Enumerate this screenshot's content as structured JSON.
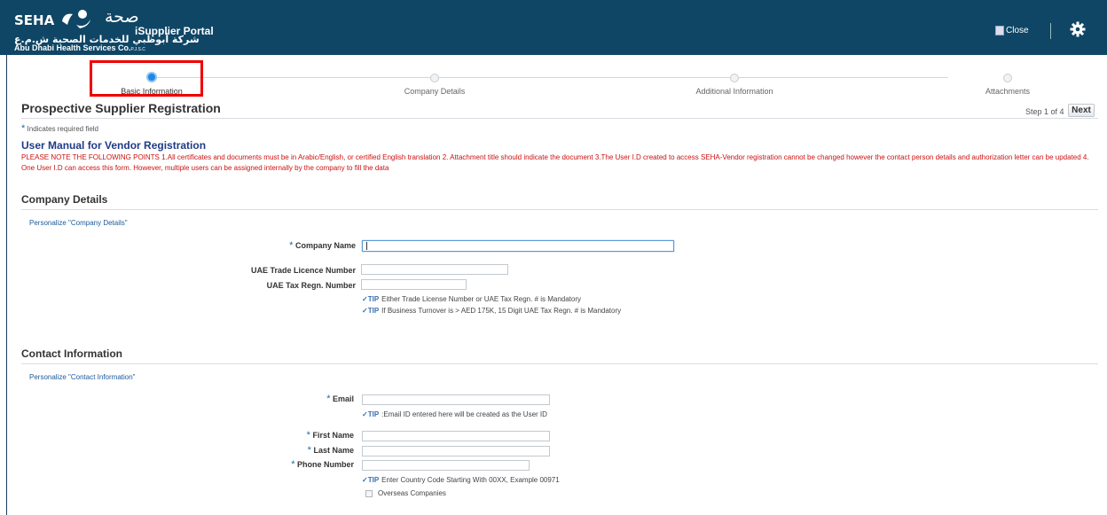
{
  "header": {
    "logo_text": "SEHA",
    "logo_arabic": "صحة",
    "logo_arabic_sub": "شركة أبوظبي للخدمات الصحية ش.م.ع",
    "logo_company": "Abu Dhabi Health Services Co.",
    "logo_company_suffix": "P.J.S.C",
    "portal_title": "iSupplier Portal",
    "close_label": "Close",
    "bg_color": "#0f4666"
  },
  "train": {
    "steps": [
      {
        "label": "Basic Information",
        "state": "active"
      },
      {
        "label": "Company Details",
        "state": "inactive"
      },
      {
        "label": "Additional Information",
        "state": "inactive"
      },
      {
        "label": "Attachments",
        "state": "inactive"
      }
    ]
  },
  "page": {
    "title": "Prospective Supplier Registration",
    "step_text": "Step 1 of 4",
    "next_label": "Next",
    "required_star": "*",
    "required_note": "Indicates required field",
    "manual_title": "User Manual for Vendor Registration",
    "notice": "PLEASE NOTE THE FOLLOWING POINTS 1.All certificates and documents must be in Arabic/English, or certified English translation 2. Attachment title should indicate the document 3.The User I.D created to access SEHA-Vendor registration cannot be changed however the contact person details and authorization letter can be updated 4. One User I.D can access this form. However, multiple users can be assigned internally by the company to fill the data"
  },
  "company": {
    "heading": "Company Details",
    "personalize": "Personalize \"Company Details\"",
    "name_label": "Company Name",
    "name_value": "",
    "trade_label": "UAE Trade Licence Number",
    "trade_value": "",
    "tax_label": "UAE Tax Regn. Number",
    "tax_value": "",
    "tip_word": "TIP",
    "tip1": "Either Trade License Number or UAE Tax Regn. # is Mandatory",
    "tip2": "If Business Turnover is > AED 175K, 15 Digit UAE Tax Regn. # is Mandatory"
  },
  "contact": {
    "heading": "Contact Information",
    "personalize": "Personalize \"Contact Information\"",
    "email_label": "Email",
    "email_tip": ":Email ID entered here will be created as the User ID",
    "first_label": "First Name",
    "last_label": "Last Name",
    "phone_label": "Phone Number",
    "phone_tip": "Enter Country Code Starting With 00XX, Example 00971",
    "overseas_label": "Overseas Companies",
    "overseas_checked": false
  }
}
